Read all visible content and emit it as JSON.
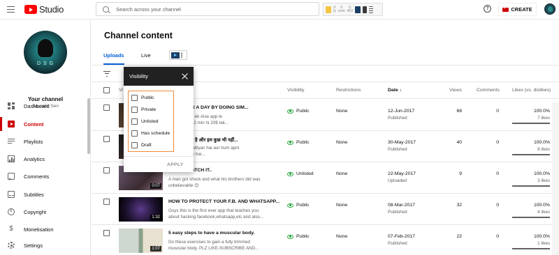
{
  "header": {
    "logo_text": "Studio",
    "search_placeholder": "Search across your channel",
    "ext_numbers": [
      "0",
      "0",
      "0",
      "0",
      "0"
    ],
    "ext_labels": [
      "fy",
      "eom",
      "403"
    ],
    "create_label": "CREATE"
  },
  "sidebar": {
    "channel_label": "Your channel",
    "channel_name": "Saurabh Sen",
    "items": [
      {
        "label": "Dashboard"
      },
      {
        "label": "Content"
      },
      {
        "label": "Playlists"
      },
      {
        "label": "Analytics"
      },
      {
        "label": "Comments"
      },
      {
        "label": "Subtitles"
      },
      {
        "label": "Copyright"
      },
      {
        "label": "Monetisation"
      },
      {
        "label": "Settings"
      }
    ]
  },
  "main": {
    "title": "Channel content",
    "tabs": [
      {
        "label": "Uploads"
      },
      {
        "label": "Live"
      }
    ],
    "columns": {
      "video": "Vi",
      "visibility": "Visibility",
      "restrictions": "Restrictions",
      "date": "Date",
      "views": "Views",
      "comments": "Comments",
      "likes": "Likes (vs. dislikes)"
    }
  },
  "popup": {
    "title": "Visibility",
    "options": [
      "Public",
      "Private",
      "Unlisted",
      "Has schedule",
      "Draft"
    ],
    "apply": "APPLY"
  },
  "rows": [
    {
      "title": "20 DOLLAR A DAY BY DOING SIM...",
      "desc": "ap Seb k liye ek Aise app le\nse aap sirf 1-2 min hi 20$ tak...",
      "visibility": "Public",
      "restrictions": "None",
      "date": "12-Jun-2017",
      "date_status": "Published",
      "views": "68",
      "comments": "0",
      "likes_pct": "100.0%",
      "likes_count": "7 likes",
      "likes_ratio": 1.0
    },
    {
      "title": "ढाता ही या रहा है और हम कुछ भी नहीं...",
      "desc": "Seb ki kya galtiyan hai aur hum apni\nhai aur Sakte hai...",
      "visibility": "Public",
      "restrictions": "None",
      "date": "30-May-2017",
      "date_status": "Published",
      "views": "40",
      "comments": "0",
      "likes_pct": "100.0%",
      "likes_count": "8 likes",
      "likes_ratio": 1.0
    },
    {
      "title": "...MUST WATCH IT..",
      "desc": "A man got shock and what his brothers did was\nunbelievable 😊",
      "visibility": "Unlisted",
      "restrictions": "None",
      "date": "22-May-2017",
      "date_status": "Uploaded",
      "views": "9",
      "comments": "0",
      "likes_pct": "100.0%",
      "likes_count": "3 likes",
      "likes_ratio": 1.0,
      "duration": "0:07"
    },
    {
      "title": "HOW TO PROTECT YOUR F.B. AND WHATSAPP...",
      "desc": "Guys this is the first ever app that teaches you\nabout hacking facebook,whatsapp,etc and also...",
      "visibility": "Public",
      "restrictions": "None",
      "date": "08-Mar-2017",
      "date_status": "Published",
      "views": "32",
      "comments": "0",
      "likes_pct": "100.0%",
      "likes_count": "4 likes",
      "likes_ratio": 1.0,
      "duration": "1:32"
    },
    {
      "title": "5 easy steps to have a muscular body.",
      "desc": "Do these exercises to gain a fully trimmed\nmuscular body. PLZ LIKE-SUBSCRIBE AND...",
      "visibility": "Public",
      "restrictions": "None",
      "date": "07-Feb-2017",
      "date_status": "Published",
      "views": "22",
      "comments": "0",
      "likes_pct": "100.0%",
      "likes_count": "1 likes",
      "likes_ratio": 1.0,
      "duration": "1:07"
    }
  ]
}
